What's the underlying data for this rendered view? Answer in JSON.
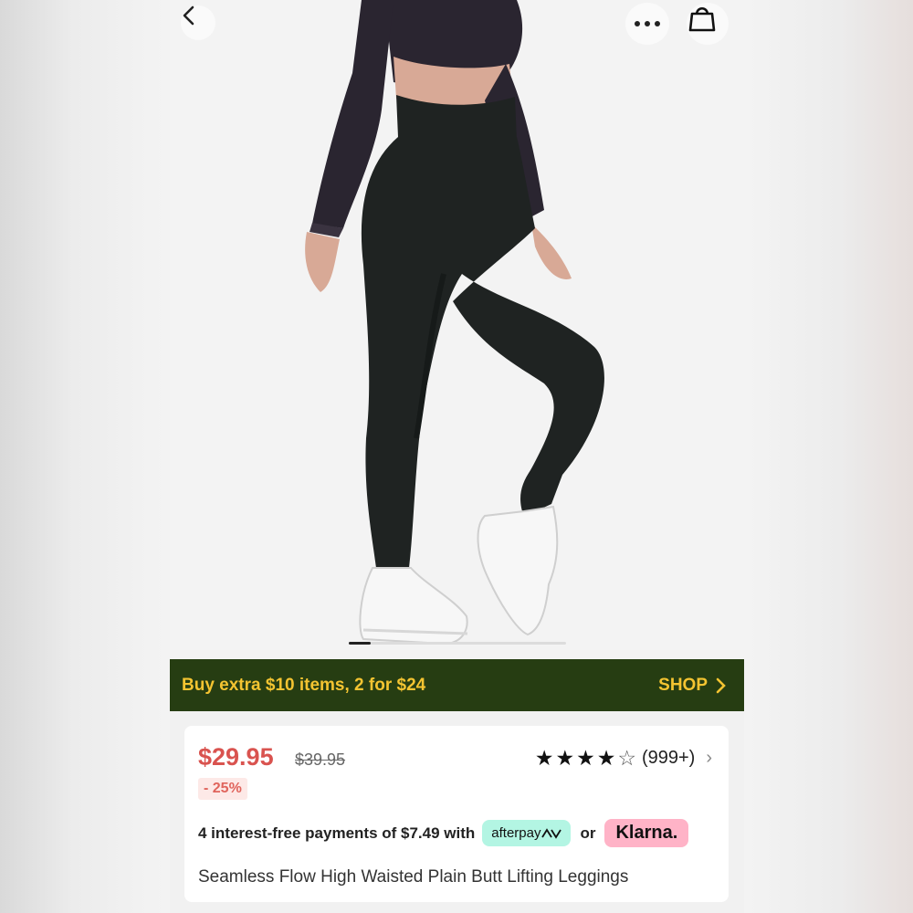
{
  "nav": {
    "back_icon": "chevron-left-icon",
    "more_icon": "more-horizontal-icon",
    "bag_icon": "shopping-bag-icon"
  },
  "gallery": {
    "current_index": 1,
    "image_alt": "Model wearing black high waisted leggings with white sneakers"
  },
  "promo": {
    "text": "Buy extra $10 items, 2 for $24",
    "shop_label": "SHOP",
    "background": "#263d12",
    "accent": "#f4c431"
  },
  "product": {
    "price": "$29.95",
    "original_price": "$39.95",
    "discount": "- 25%",
    "rating": 4,
    "rating_max": 5,
    "review_count": "(999+)",
    "title": "Seamless Flow High Waisted Plain Butt Lifting Leggings"
  },
  "payment": {
    "text": "4 interest-free payments of $7.49 with",
    "afterpay_label": "afterpay",
    "or_label": "or",
    "klarna_label": "Klarna."
  },
  "colors": {
    "price": "#d9534f",
    "afterpay_bg": "#b3f5e3",
    "klarna_bg": "#ffb3c7"
  }
}
